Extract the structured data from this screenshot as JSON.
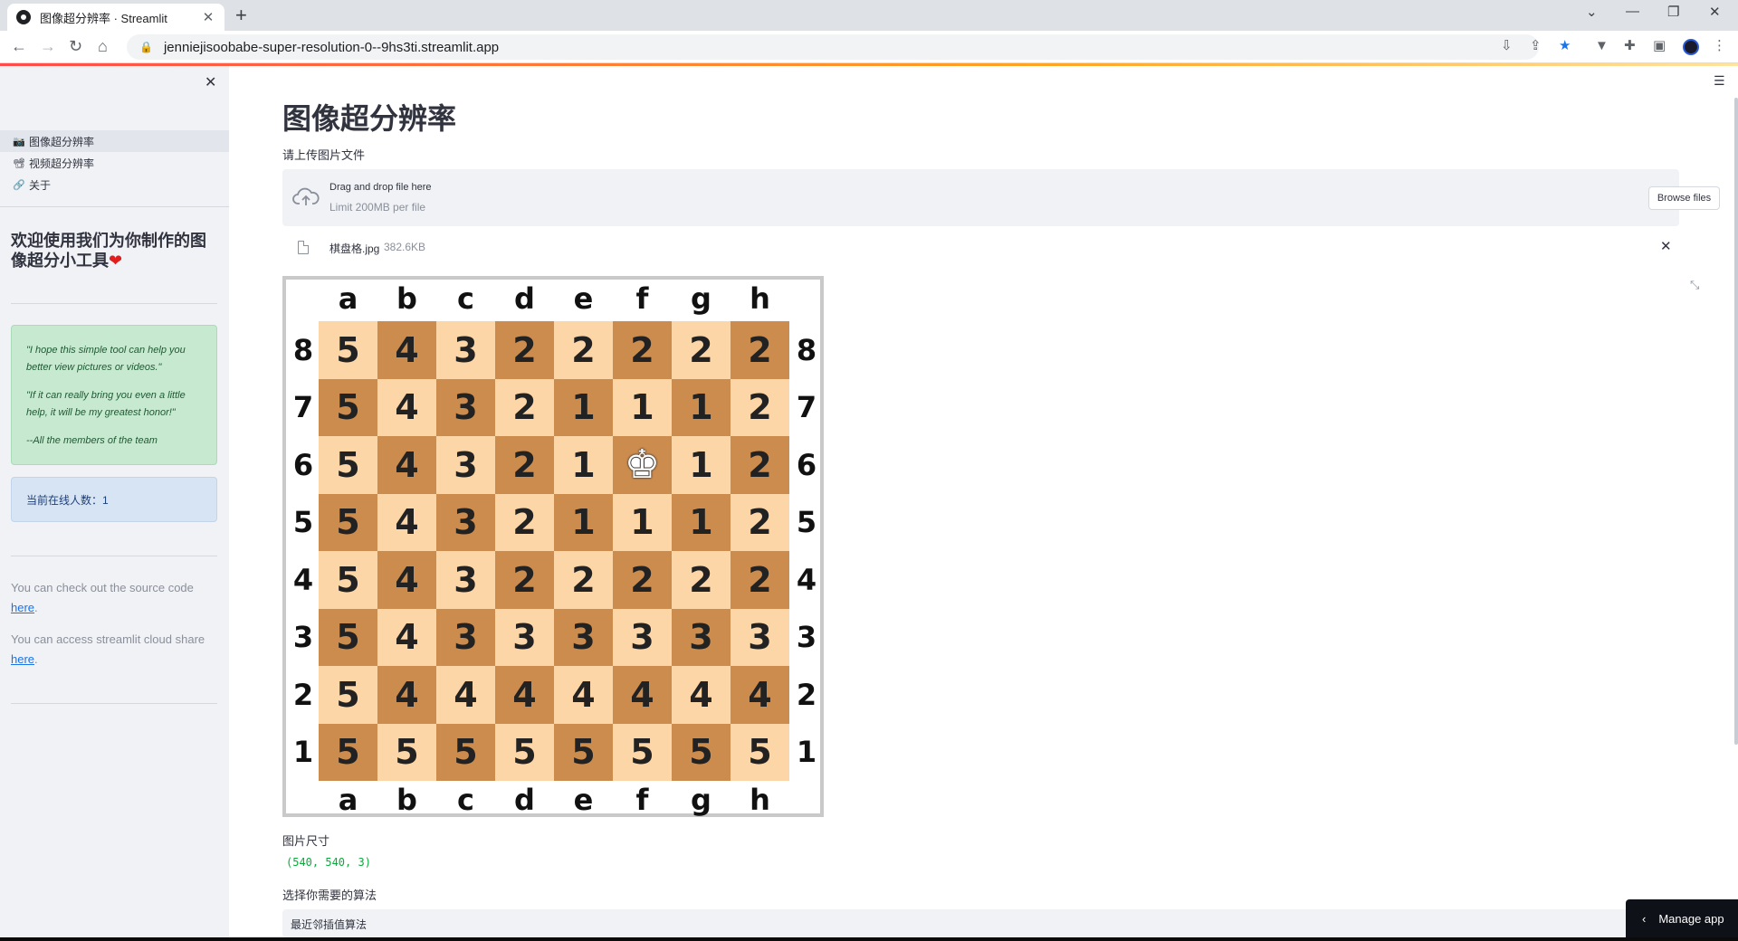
{
  "browser": {
    "tab_title": "图像超分辨率 · Streamlit",
    "tab_close": "✕",
    "new_tab": "+",
    "url": "jenniejisoobabe-super-resolution-0--9hs3ti.streamlit.app",
    "window_controls": [
      "⌄",
      "—",
      "❐",
      "✕"
    ]
  },
  "sidebar": {
    "close": "✕",
    "nav": [
      {
        "icon": "📷",
        "label": "图像超分辨率",
        "active": true
      },
      {
        "icon": "📽",
        "label": "视频超分辨率",
        "active": false
      },
      {
        "icon": "🔗",
        "label": "关于",
        "active": false
      }
    ],
    "welcome": "欢迎使用我们为你制作的图像超分小工具",
    "heart": "❤",
    "quotes": [
      "\"I hope this simple tool can help you better view pictures or videos.\"",
      "\"If it can really bring you even a little help, it will be my greatest honor!\"",
      "--All the members of the team"
    ],
    "online_text": "当前在线人数：1",
    "source_text": "You can check out the source code",
    "source_link": "here",
    "share_text": "You can access streamlit cloud share",
    "share_link": "here",
    "period": "."
  },
  "main": {
    "title": "图像超分辨率",
    "upload_label": "请上传图片文件",
    "dropzone_title": "Drag and drop file here",
    "dropzone_limit": "Limit 200MB per file",
    "browse_button": "Browse files",
    "file_name": "棋盘格.jpg",
    "file_size": "382.6KB",
    "file_remove": "✕",
    "size_label": "图片尺寸",
    "size_value": "(540, 540, 3)",
    "algo_label": "选择你需要的算法",
    "algo_selected": "最近邻插值算法",
    "manage_app": "Manage app"
  },
  "chessboard": {
    "files": [
      "a",
      "b",
      "c",
      "d",
      "e",
      "f",
      "g",
      "h"
    ],
    "ranks": [
      "8",
      "7",
      "6",
      "5",
      "4",
      "3",
      "2",
      "1"
    ],
    "rows": [
      [
        "5",
        "4",
        "3",
        "2",
        "2",
        "2",
        "2",
        "2"
      ],
      [
        "5",
        "4",
        "3",
        "2",
        "1",
        "1",
        "1",
        "2"
      ],
      [
        "5",
        "4",
        "3",
        "2",
        "1",
        "♚",
        "1",
        "2"
      ],
      [
        "5",
        "4",
        "3",
        "2",
        "1",
        "1",
        "1",
        "2"
      ],
      [
        "5",
        "4",
        "3",
        "2",
        "2",
        "2",
        "2",
        "2"
      ],
      [
        "5",
        "4",
        "3",
        "3",
        "3",
        "3",
        "3",
        "3"
      ],
      [
        "5",
        "4",
        "4",
        "4",
        "4",
        "4",
        "4",
        "4"
      ],
      [
        "5",
        "5",
        "5",
        "5",
        "5",
        "5",
        "5",
        "5"
      ]
    ],
    "colors": {
      "light": "#fdd6a8",
      "dark": "#cc8c4e"
    }
  }
}
